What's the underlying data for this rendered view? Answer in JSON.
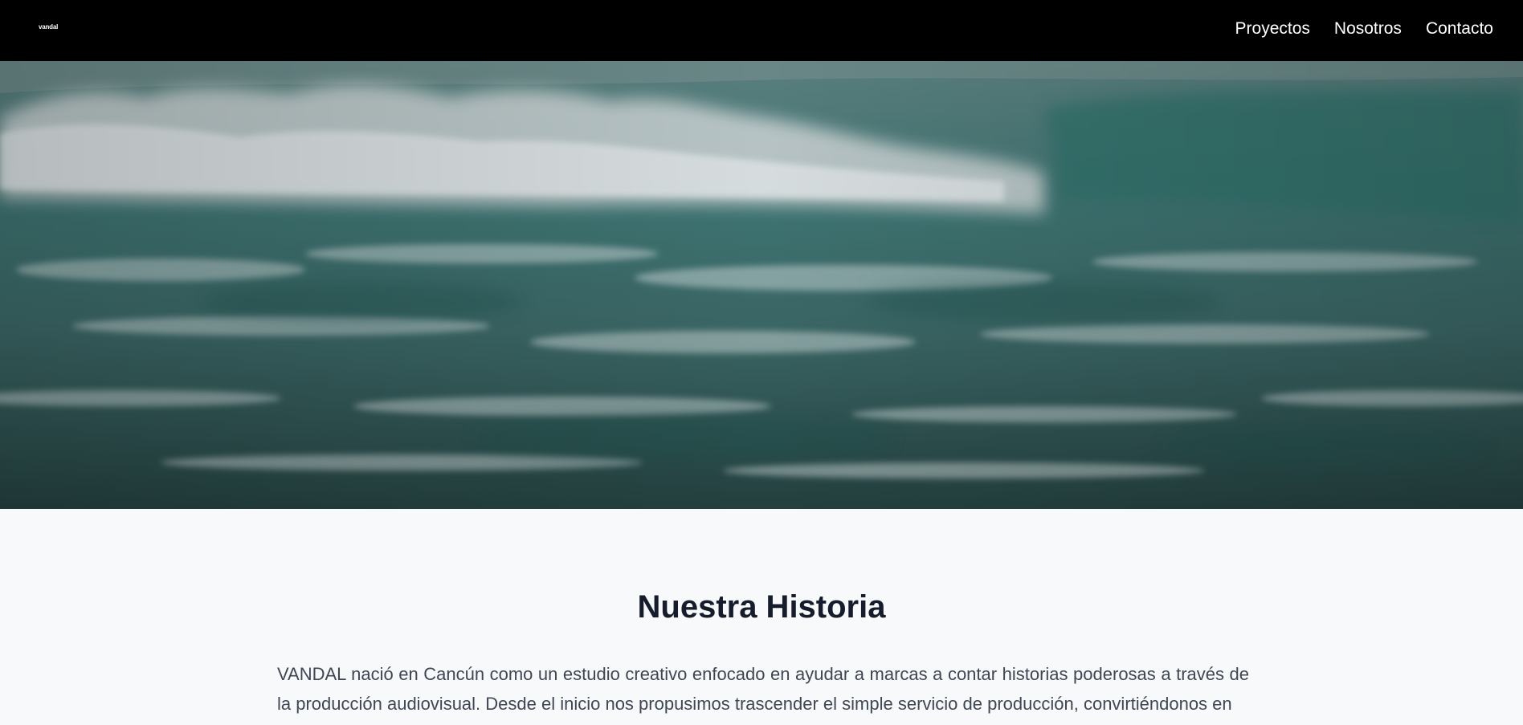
{
  "nav": {
    "logo_text": "vandal",
    "links": [
      {
        "label": "Proyectos"
      },
      {
        "label": "Nosotros"
      },
      {
        "label": "Contacto"
      }
    ]
  },
  "hero": {
    "image_semantic": "ocean-wave-image"
  },
  "section": {
    "title": "Nuestra Historia",
    "paragraph": "VANDAL nació en Cancún como un estudio creativo enfocado en ayudar a marcas a contar historias poderosas a través de la producción audiovisual. Desde el inicio nos propusimos trascender el simple servicio de producción, convirtiéndonos en"
  },
  "colors": {
    "nav_bg": "#000000",
    "page_bg": "#f8f9fb",
    "title": "#151c2c",
    "body_text": "#3f4654"
  }
}
